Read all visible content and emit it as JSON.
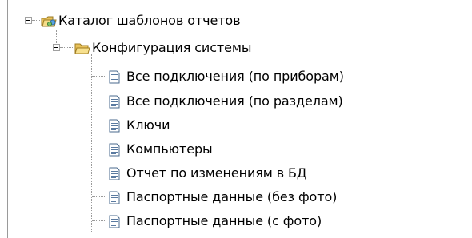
{
  "tree": {
    "root": {
      "label": "Каталог шаблонов отчетов",
      "icon": "catalog-folder-icon",
      "expanded": true
    },
    "folder": {
      "label": "Конфигурация системы",
      "icon": "open-folder-icon",
      "expanded": true
    },
    "items": [
      {
        "label": "Все подключения (по приборам)",
        "icon": "report-document-icon"
      },
      {
        "label": "Все подключения (по разделам)",
        "icon": "report-document-icon"
      },
      {
        "label": "Ключи",
        "icon": "report-document-icon"
      },
      {
        "label": "Компьютеры",
        "icon": "report-document-icon"
      },
      {
        "label": "Отчет по изменениям в БД",
        "icon": "report-document-icon"
      },
      {
        "label": "Паспортные данные (без фото)",
        "icon": "report-document-icon"
      },
      {
        "label": "Паспортные данные (с фото)",
        "icon": "report-document-icon"
      }
    ]
  }
}
